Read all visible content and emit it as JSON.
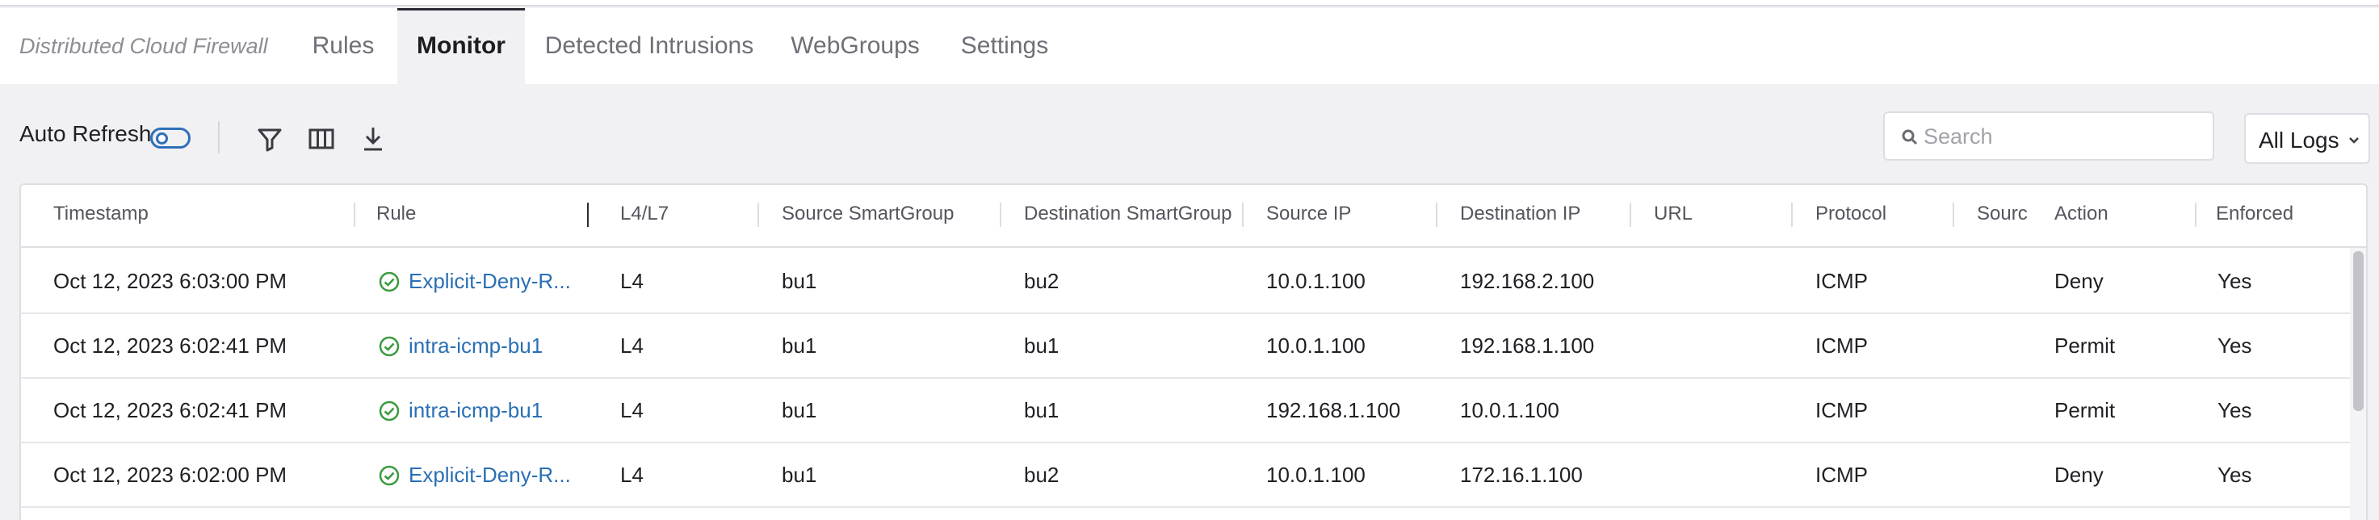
{
  "brand": "Distributed Cloud Firewall",
  "tabs": [
    {
      "label": "Rules",
      "active": false
    },
    {
      "label": "Monitor",
      "active": true
    },
    {
      "label": "Detected Intrusions",
      "active": false
    },
    {
      "label": "WebGroups",
      "active": false
    },
    {
      "label": "Settings",
      "active": false
    }
  ],
  "toolbar": {
    "auto_refresh_label": "Auto Refresh",
    "auto_refresh_on": false,
    "icons": [
      "filter-icon",
      "columns-icon",
      "download-icon"
    ]
  },
  "search": {
    "placeholder": "Search",
    "value": ""
  },
  "log_filter": {
    "selected": "All Logs"
  },
  "colors": {
    "accent": "#2f6fb8",
    "link": "#2a6fb5",
    "success": "#3a9b3e"
  },
  "table": {
    "columns": [
      "Timestamp",
      "Rule",
      "L4/L7",
      "Source SmartGroup",
      "Destination SmartGroup",
      "Source IP",
      "Destination IP",
      "URL",
      "Protocol",
      "Sourc",
      "Action",
      "Enforced"
    ],
    "rows": [
      {
        "timestamp": "Oct 12, 2023 6:03:00 PM",
        "rule": "Explicit-Deny-R...",
        "l4l7": "L4",
        "src_group": "bu1",
        "dst_group": "bu2",
        "src_ip": "10.0.1.100",
        "dst_ip": "192.168.2.100",
        "url": "",
        "protocol": "ICMP",
        "src_port": "",
        "action": "Deny",
        "enforced": "Yes"
      },
      {
        "timestamp": "Oct 12, 2023 6:02:41 PM",
        "rule": "intra-icmp-bu1",
        "l4l7": "L4",
        "src_group": "bu1",
        "dst_group": "bu1",
        "src_ip": "10.0.1.100",
        "dst_ip": "192.168.1.100",
        "url": "",
        "protocol": "ICMP",
        "src_port": "",
        "action": "Permit",
        "enforced": "Yes"
      },
      {
        "timestamp": "Oct 12, 2023 6:02:41 PM",
        "rule": "intra-icmp-bu1",
        "l4l7": "L4",
        "src_group": "bu1",
        "dst_group": "bu1",
        "src_ip": "192.168.1.100",
        "dst_ip": "10.0.1.100",
        "url": "",
        "protocol": "ICMP",
        "src_port": "",
        "action": "Permit",
        "enforced": "Yes"
      },
      {
        "timestamp": "Oct 12, 2023 6:02:00 PM",
        "rule": "Explicit-Deny-R...",
        "l4l7": "L4",
        "src_group": "bu1",
        "dst_group": "bu2",
        "src_ip": "10.0.1.100",
        "dst_ip": "172.16.1.100",
        "url": "",
        "protocol": "ICMP",
        "src_port": "",
        "action": "Deny",
        "enforced": "Yes"
      }
    ]
  }
}
